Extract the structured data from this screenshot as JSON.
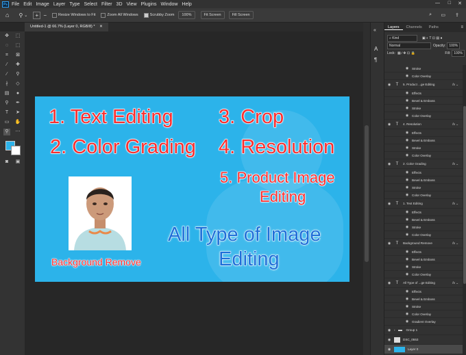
{
  "menubar": {
    "logo": "Ps",
    "items": [
      "File",
      "Edit",
      "Image",
      "Layer",
      "Type",
      "Select",
      "Filter",
      "3D",
      "View",
      "Plugins",
      "Window",
      "Help"
    ]
  },
  "options": {
    "resize_windows": "Resize Windows to Fit",
    "zoom_all": "Zoom All Windows",
    "scrubby_zoom": "Scrubby Zoom",
    "zoom_value": "100%",
    "fit_screen": "Fit Screen",
    "fill_screen": "Fill Screen"
  },
  "document_tab": "Untitled-1 @ 66.7% (Layer 0, RGB/8) *",
  "artwork": {
    "line1": "1. Text Editing",
    "line2": "2. Color Grading",
    "line3": "3. Crop",
    "line4": "4. Resolution",
    "line5a": "5. Product Image",
    "line5b": "Editing",
    "bg_remove": "Background Remove",
    "all_type_a": "All Type of Image",
    "all_type_b": "Editing"
  },
  "panel": {
    "tabs": [
      "Layers",
      "Channels",
      "Paths"
    ],
    "kind": "Kind",
    "blend_mode": "Normal",
    "opacity_label": "Opacity:",
    "opacity_value": "100%",
    "lock_label": "Lock:",
    "fill_label": "Fill:",
    "fill_value": "100%",
    "layers": [
      {
        "kind": "fx",
        "label": "Stroke"
      },
      {
        "kind": "fx",
        "label": "Color Overlay"
      },
      {
        "kind": "layer",
        "label": "5. Product ...ge  Editing",
        "fx": true,
        "thumb": "T"
      },
      {
        "kind": "fx",
        "label": "Effects"
      },
      {
        "kind": "fx",
        "label": "Bevel & Emboss"
      },
      {
        "kind": "fx",
        "label": "Stroke"
      },
      {
        "kind": "fx",
        "label": "Color Overlay"
      },
      {
        "kind": "layer",
        "label": "4. Resolution",
        "fx": true,
        "thumb": "T"
      },
      {
        "kind": "fx",
        "label": "Effects"
      },
      {
        "kind": "fx",
        "label": "Bevel & Emboss"
      },
      {
        "kind": "fx",
        "label": "Stroke"
      },
      {
        "kind": "fx",
        "label": "Color Overlay"
      },
      {
        "kind": "layer",
        "label": "2. Color Grading",
        "fx": true,
        "thumb": "T"
      },
      {
        "kind": "fx",
        "label": "Effects"
      },
      {
        "kind": "fx",
        "label": "Bevel & Emboss"
      },
      {
        "kind": "fx",
        "label": "Stroke"
      },
      {
        "kind": "fx",
        "label": "Color Overlay"
      },
      {
        "kind": "layer",
        "label": "1. Text Editing",
        "fx": true,
        "thumb": "T"
      },
      {
        "kind": "fx",
        "label": "Effects"
      },
      {
        "kind": "fx",
        "label": "Bevel & Emboss"
      },
      {
        "kind": "fx",
        "label": "Stroke"
      },
      {
        "kind": "fx",
        "label": "Color Overlay"
      },
      {
        "kind": "layer",
        "label": "Background Remove",
        "fx": true,
        "thumb": "T"
      },
      {
        "kind": "fx",
        "label": "Effects"
      },
      {
        "kind": "fx",
        "label": "Bevel & Emboss"
      },
      {
        "kind": "fx",
        "label": "Stroke"
      },
      {
        "kind": "fx",
        "label": "Color Overlay"
      },
      {
        "kind": "layer",
        "label": "All Type of ...ge  Editing",
        "fx": true,
        "thumb": "T"
      },
      {
        "kind": "fx",
        "label": "Effects"
      },
      {
        "kind": "fx",
        "label": "Bevel & Emboss"
      },
      {
        "kind": "fx",
        "label": "Stroke"
      },
      {
        "kind": "fx",
        "label": "Color Overlay"
      },
      {
        "kind": "fx",
        "label": "Gradient Overlay"
      },
      {
        "kind": "layer",
        "label": "Group 1",
        "thumb": "folder"
      },
      {
        "kind": "layer",
        "label": "DSC_0553",
        "thumb": "img"
      },
      {
        "kind": "layer",
        "label": "Layer 0",
        "thumb": "blue",
        "selected": true
      }
    ]
  }
}
